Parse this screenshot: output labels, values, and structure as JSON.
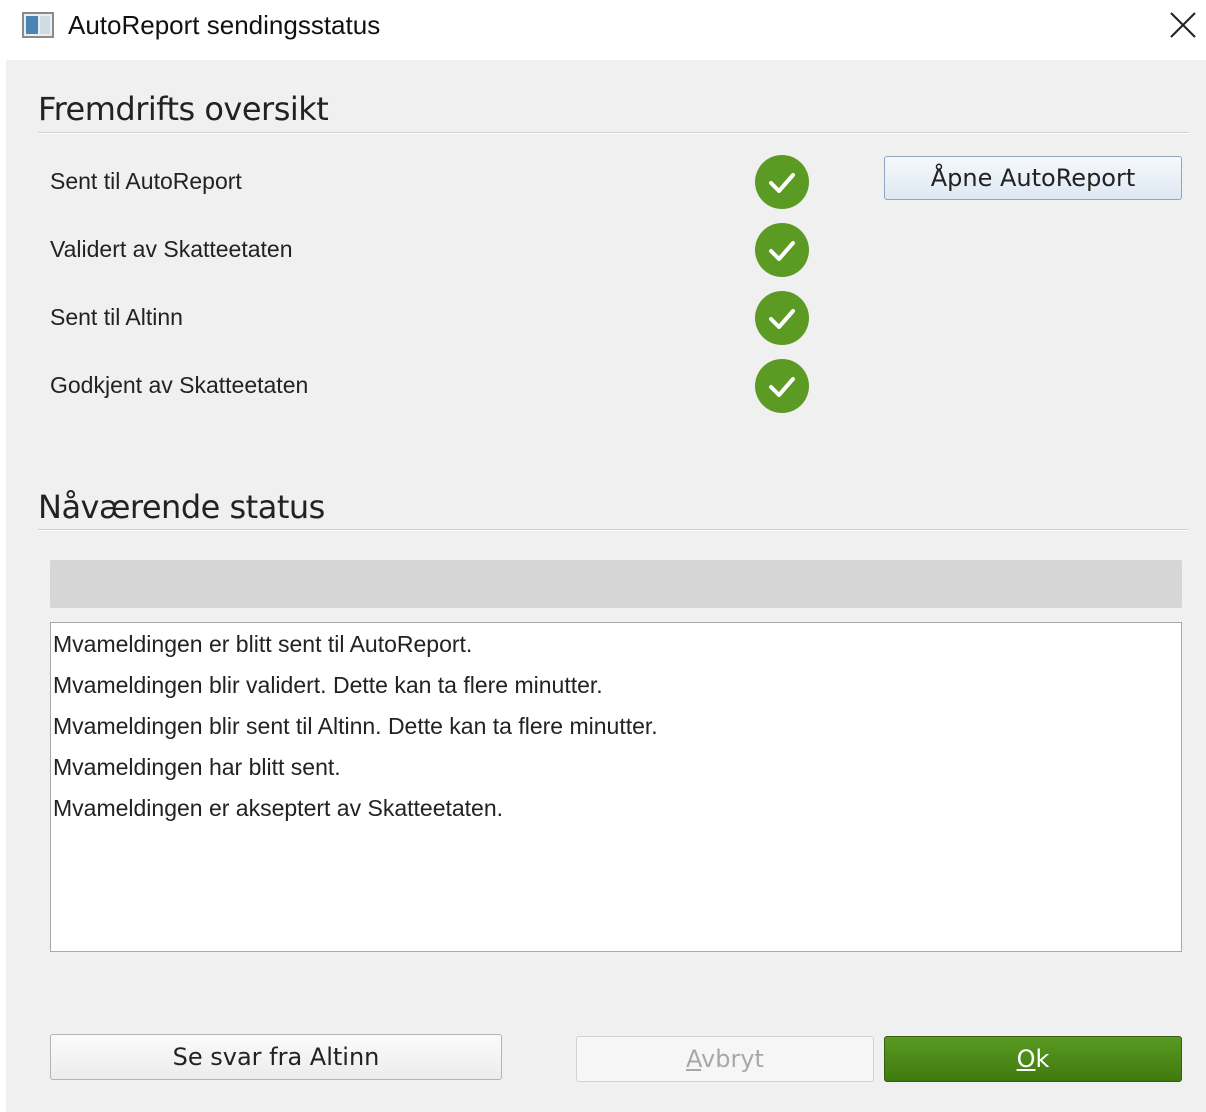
{
  "window": {
    "title": "AutoReport sendingsstatus",
    "app_icon": "window-app-icon",
    "close_icon": "close-icon"
  },
  "progress_section": {
    "title": "Fremdrifts oversikt",
    "steps": [
      {
        "label": "Sent til AutoReport",
        "status": "done",
        "icon": "check-circle-icon"
      },
      {
        "label": "Validert av Skatteetaten",
        "status": "done",
        "icon": "check-circle-icon"
      },
      {
        "label": "Sent til Altinn",
        "status": "done",
        "icon": "check-circle-icon"
      },
      {
        "label": "Godkjent av Skatteetaten",
        "status": "done",
        "icon": "check-circle-icon"
      }
    ],
    "open_button_label": "Åpne AutoReport"
  },
  "status_section": {
    "title": "Nåværende status",
    "progress_fraction": 0,
    "log": [
      "Mvameldingen er blitt sent til AutoReport.",
      "Mvameldingen blir validert. Dette kan ta flere minutter.",
      "Mvameldingen blir sent til Altinn. Dette kan ta flere minutter.",
      "Mvameldingen har blitt sent.",
      "Mvameldingen er akseptert av Skatteetaten."
    ]
  },
  "buttons": {
    "altinn_label": "Se svar fra Altinn",
    "cancel_mnemonic": "A",
    "cancel_rest": "vbryt",
    "ok_mnemonic": "O",
    "ok_rest": "k"
  },
  "colors": {
    "check_green": "#5b9a23",
    "ok_button": "#4a8518",
    "dialog_bg": "#f0f0f0"
  }
}
